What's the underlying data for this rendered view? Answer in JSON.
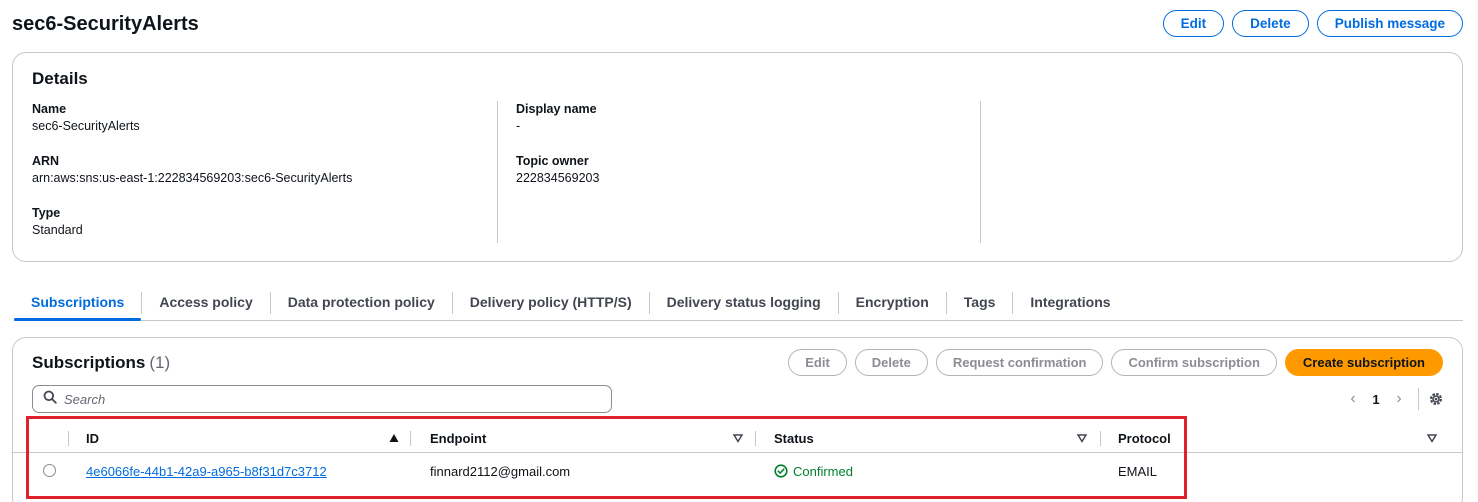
{
  "page": {
    "title": "sec6-SecurityAlerts"
  },
  "header_actions": {
    "edit": "Edit",
    "delete": "Delete",
    "publish": "Publish message"
  },
  "details": {
    "title": "Details",
    "name_label": "Name",
    "name_value": "sec6-SecurityAlerts",
    "arn_label": "ARN",
    "arn_value": "arn:aws:sns:us-east-1:222834569203:sec6-SecurityAlerts",
    "type_label": "Type",
    "type_value": "Standard",
    "display_name_label": "Display name",
    "display_name_value": "-",
    "topic_owner_label": "Topic owner",
    "topic_owner_value": "222834569203"
  },
  "tabs": [
    {
      "label": "Subscriptions",
      "active": true
    },
    {
      "label": "Access policy"
    },
    {
      "label": "Data protection policy"
    },
    {
      "label": "Delivery policy (HTTP/S)"
    },
    {
      "label": "Delivery status logging"
    },
    {
      "label": "Encryption"
    },
    {
      "label": "Tags"
    },
    {
      "label": "Integrations"
    }
  ],
  "subscriptions": {
    "title": "Subscriptions",
    "count": "(1)",
    "actions": {
      "edit": "Edit",
      "delete": "Delete",
      "request_confirmation": "Request confirmation",
      "confirm_subscription": "Confirm subscription",
      "create": "Create subscription"
    },
    "search_placeholder": "Search",
    "pagination": {
      "current_page": "1"
    },
    "columns": {
      "id": "ID",
      "endpoint": "Endpoint",
      "status": "Status",
      "protocol": "Protocol"
    },
    "rows": [
      {
        "id": "4e6066fe-44b1-42a9-a965-b8f31d7c3712",
        "endpoint": "finnard2112@gmail.com",
        "status": "Confirmed",
        "protocol": "EMAIL"
      }
    ]
  },
  "colors": {
    "accent": "#006ce0",
    "primary_button": "#ff9900",
    "success": "#00802f",
    "highlight": "#e0202a"
  }
}
